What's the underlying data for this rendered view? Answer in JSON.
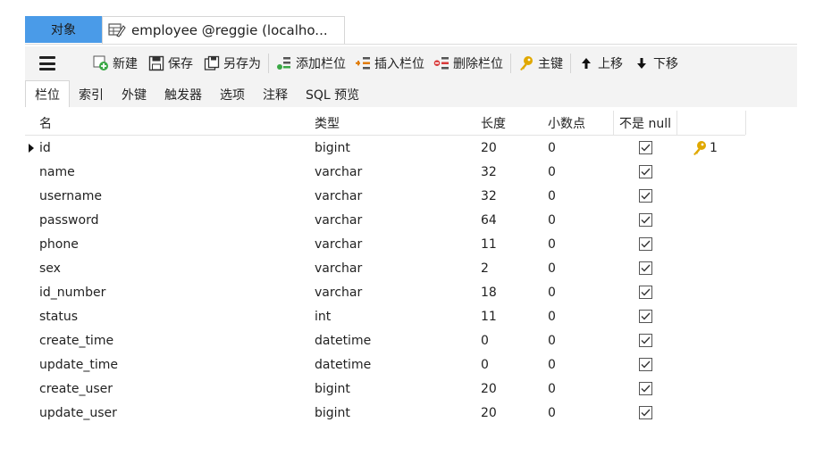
{
  "tabs": {
    "objects_label": "对象",
    "document_title": "employee @reggie (localho..."
  },
  "toolbar": {
    "new_label": "新建",
    "save_label": "保存",
    "save_as_label": "另存为",
    "add_field_label": "添加栏位",
    "insert_field_label": "插入栏位",
    "delete_field_label": "删除栏位",
    "primary_key_label": "主键",
    "move_up_label": "上移",
    "move_down_label": "下移"
  },
  "subtabs": [
    "栏位",
    "索引",
    "外键",
    "触发器",
    "选项",
    "注释",
    "SQL 预览"
  ],
  "columns": {
    "name": "名",
    "type": "类型",
    "length": "长度",
    "decimals": "小数点",
    "not_null": "不是 null"
  },
  "rows": [
    {
      "name": "id",
      "type": "bigint",
      "length": "20",
      "decimals": "0",
      "key": "1"
    },
    {
      "name": "name",
      "type": "varchar",
      "length": "32",
      "decimals": "0",
      "key": ""
    },
    {
      "name": "username",
      "type": "varchar",
      "length": "32",
      "decimals": "0",
      "key": ""
    },
    {
      "name": "password",
      "type": "varchar",
      "length": "64",
      "decimals": "0",
      "key": ""
    },
    {
      "name": "phone",
      "type": "varchar",
      "length": "11",
      "decimals": "0",
      "key": ""
    },
    {
      "name": "sex",
      "type": "varchar",
      "length": "2",
      "decimals": "0",
      "key": ""
    },
    {
      "name": "id_number",
      "type": "varchar",
      "length": "18",
      "decimals": "0",
      "key": ""
    },
    {
      "name": "status",
      "type": "int",
      "length": "11",
      "decimals": "0",
      "key": ""
    },
    {
      "name": "create_time",
      "type": "datetime",
      "length": "0",
      "decimals": "0",
      "key": ""
    },
    {
      "name": "update_time",
      "type": "datetime",
      "length": "0",
      "decimals": "0",
      "key": ""
    },
    {
      "name": "create_user",
      "type": "bigint",
      "length": "20",
      "decimals": "0",
      "key": ""
    },
    {
      "name": "update_user",
      "type": "bigint",
      "length": "20",
      "decimals": "0",
      "key": ""
    }
  ],
  "colors": {
    "active_tab": "#4a9be8",
    "key_icon": "#e0a800",
    "new_icon": "#3aa845",
    "insert_icon": "#e07a00",
    "delete_icon": "#d93a3a"
  }
}
